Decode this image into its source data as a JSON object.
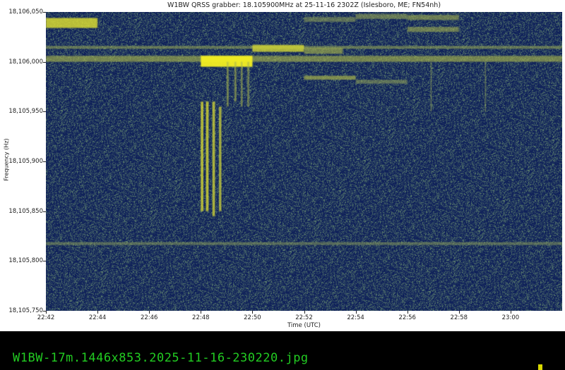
{
  "chart_data": {
    "type": "heatmap",
    "title": "W1BW QRSS grabber: 18.105900MHz at 25-11-16 2302Z (Islesboro, ME; FN54nh)",
    "xlabel": "Time (UTC)",
    "ylabel": "Frequency (Hz)",
    "xlim_minutes_after_2242": [
      0,
      20
    ],
    "ylim": [
      18105750,
      18106050
    ],
    "xticks": [
      "22:42",
      "22:44",
      "22:46",
      "22:48",
      "22:50",
      "22:52",
      "22:54",
      "22:56",
      "22:58",
      "23:00"
    ],
    "yticks": [
      {
        "value": 18106050,
        "label": "18,106,050"
      },
      {
        "value": 18106000,
        "label": "18,106,000"
      },
      {
        "value": 18105950,
        "label": "18,105,950"
      },
      {
        "value": 18105900,
        "label": "18,105,900"
      },
      {
        "value": 18105850,
        "label": "18,105,850"
      },
      {
        "value": 18105800,
        "label": "18,105,800"
      },
      {
        "value": 18105750,
        "label": "18,105,750"
      }
    ],
    "colormap": {
      "low": "#0d1e5a",
      "mid": "#6f8a70",
      "high": "#f5f020"
    },
    "signals": [
      {
        "t0": 0.0,
        "t1": 2.0,
        "f0": 18106034,
        "f1": 18106044,
        "intensity": 0.8
      },
      {
        "t0": 0.0,
        "t1": 20.0,
        "f0": 18106013,
        "f1": 18106016,
        "intensity": 0.35
      },
      {
        "t0": 0.0,
        "t1": 20.0,
        "f0": 18106000,
        "f1": 18106006,
        "intensity": 0.45
      },
      {
        "t0": 6.0,
        "t1": 8.0,
        "f0": 18105995,
        "f1": 18106006,
        "intensity": 1.0
      },
      {
        "t0": 8.0,
        "t1": 10.0,
        "f0": 18106010,
        "f1": 18106017,
        "intensity": 0.75
      },
      {
        "t0": 10.0,
        "t1": 11.5,
        "f0": 18106008,
        "f1": 18106014,
        "intensity": 0.45
      },
      {
        "t0": 10.0,
        "t1": 12.0,
        "f0": 18105982,
        "f1": 18105986,
        "intensity": 0.5
      },
      {
        "t0": 12.0,
        "t1": 14.0,
        "f0": 18105978,
        "f1": 18105982,
        "intensity": 0.3
      },
      {
        "t0": 10.0,
        "t1": 12.0,
        "f0": 18106040,
        "f1": 18106045,
        "intensity": 0.3
      },
      {
        "t0": 12.0,
        "t1": 14.0,
        "f0": 18106043,
        "f1": 18106048,
        "intensity": 0.35
      },
      {
        "t0": 14.0,
        "t1": 16.0,
        "f0": 18106042,
        "f1": 18106047,
        "intensity": 0.4
      },
      {
        "t0": 14.0,
        "t1": 16.0,
        "f0": 18106030,
        "f1": 18106035,
        "intensity": 0.4
      },
      {
        "t0": 0.0,
        "t1": 20.0,
        "f0": 18105816,
        "f1": 18105819,
        "intensity": 0.25
      },
      {
        "t0": 6.0,
        "t1": 6.1,
        "f0": 18105850,
        "f1": 18105960,
        "intensity": 0.8
      },
      {
        "t0": 6.2,
        "t1": 6.3,
        "f0": 18105850,
        "f1": 18105960,
        "intensity": 0.8
      },
      {
        "t0": 6.45,
        "t1": 6.55,
        "f0": 18105845,
        "f1": 18105960,
        "intensity": 0.75
      },
      {
        "t0": 6.7,
        "t1": 6.8,
        "f0": 18105850,
        "f1": 18105955,
        "intensity": 0.7
      },
      {
        "t0": 7.0,
        "t1": 7.08,
        "f0": 18105955,
        "f1": 18106000,
        "intensity": 0.45
      },
      {
        "t0": 7.3,
        "t1": 7.38,
        "f0": 18105960,
        "f1": 18106000,
        "intensity": 0.45
      },
      {
        "t0": 7.55,
        "t1": 7.62,
        "f0": 18105955,
        "f1": 18106000,
        "intensity": 0.45
      },
      {
        "t0": 7.8,
        "t1": 7.88,
        "f0": 18105955,
        "f1": 18106000,
        "intensity": 0.4
      },
      {
        "t0": 14.9,
        "t1": 14.95,
        "f0": 18105950,
        "f1": 18106000,
        "intensity": 0.3
      },
      {
        "t0": 17.0,
        "t1": 17.05,
        "f0": 18105950,
        "f1": 18106000,
        "intensity": 0.3
      }
    ],
    "grid": false
  },
  "terminal": {
    "filename": "W1BW-17m.1446x853.2025-11-16-230220.jpg"
  }
}
